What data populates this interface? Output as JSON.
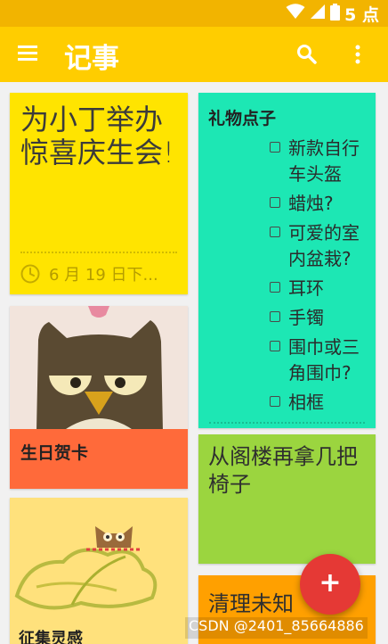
{
  "status_bar": {
    "time": "5 点",
    "icons": [
      "wifi-icon",
      "signal-icon",
      "battery-icon"
    ]
  },
  "app_bar": {
    "title": "记事",
    "icons": [
      "menu-icon",
      "search-icon",
      "more-vert-icon"
    ]
  },
  "notes": [
    {
      "title": "为小丁举办惊喜庆生会!",
      "reminder": "6 月 19 日下...",
      "color": "#ffe400"
    },
    {
      "title": "礼物点子",
      "color": "#1de7b4",
      "items": [
        "新款自行车头盔",
        "蜡烛?",
        "可爱的室内盆栽?",
        "耳环",
        "手镯",
        "围巾或三角围巾?",
        "相框"
      ]
    },
    {
      "label": "生日贺卡",
      "color": "#ff6a3a"
    },
    {
      "text": "从阁楼再拿几把椅子",
      "color": "#9bd53f"
    },
    {
      "label": "征集灵感",
      "color": "#ffe17c"
    },
    {
      "text": "清理未知",
      "color": "#ffa000"
    }
  ],
  "fab": {
    "label": "+"
  },
  "watermark": "CSDN @2401_85664886",
  "colors": {
    "status_bar": "#f2b400",
    "app_bar": "#ffcd00",
    "fab": "#e53935"
  }
}
